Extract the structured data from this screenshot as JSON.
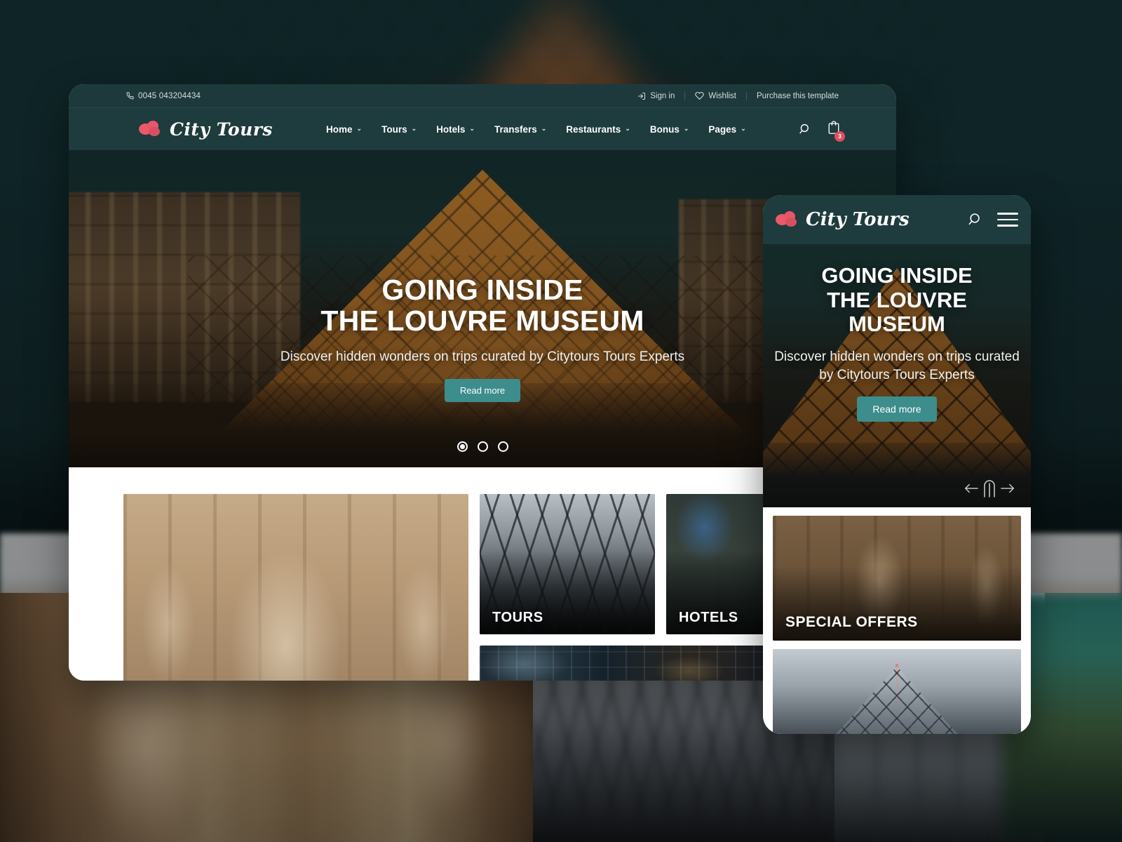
{
  "site": {
    "brand_name": "City Tours",
    "logo_icon": "cloud-logo-icon",
    "accent_teal": "#3d8d8d",
    "header_teal": "#1e3b3d",
    "accent_pink": "#e8566a"
  },
  "desktop": {
    "topbar": {
      "phone_icon": "phone-icon",
      "phone": "0045 043204434",
      "signin_icon": "sign-in-icon",
      "signin": "Sign in",
      "wishlist_icon": "heart-icon",
      "wishlist": "Wishlist",
      "purchase": "Purchase this template"
    },
    "nav": {
      "items": [
        {
          "label": "Home",
          "caret": "⌄"
        },
        {
          "label": "Tours",
          "caret": "⌄"
        },
        {
          "label": "Hotels",
          "caret": "⌄"
        },
        {
          "label": "Transfers",
          "caret": "⌄"
        },
        {
          "label": "Restaurants",
          "caret": "⌄"
        },
        {
          "label": "Bonus",
          "caret": "⌄"
        },
        {
          "label": "Pages",
          "caret": "⌄"
        }
      ],
      "search_icon": "search-icon",
      "cart_icon": "cart-icon",
      "cart_count": "3"
    },
    "hero": {
      "title_line1": "GOING INSIDE",
      "title_line2": "THE LOUVRE MUSEUM",
      "subtitle": "Discover hidden wonders on trips curated by Citytours Tours Experts",
      "button": "Read more",
      "dots": [
        {
          "active": true
        },
        {
          "active": false
        },
        {
          "active": false
        }
      ]
    },
    "tiles": [
      {
        "name": "trevi-fountain",
        "label": ""
      },
      {
        "name": "tours",
        "label": "TOURS"
      },
      {
        "name": "hotels",
        "label": "HOTELS"
      },
      {
        "name": "restaurants",
        "label": ""
      }
    ]
  },
  "mobile": {
    "nav": {
      "search_icon": "search-icon",
      "menu_icon": "hamburger-menu-icon"
    },
    "hero": {
      "title_line1": "GOING INSIDE",
      "title_line2": "THE LOUVRE",
      "title_line3": "MUSEUM",
      "subtitle": "Discover hidden wonders on trips curated by Citytours Tours Experts",
      "button": "Read more",
      "prev_icon": "arrow-left-icon",
      "drag_icon": "drag-handle-icon",
      "next_icon": "arrow-right-icon"
    },
    "tiles": [
      {
        "name": "special-offers",
        "label": "SPECIAL OFFERS"
      },
      {
        "name": "louvre-card",
        "label": ""
      }
    ]
  }
}
